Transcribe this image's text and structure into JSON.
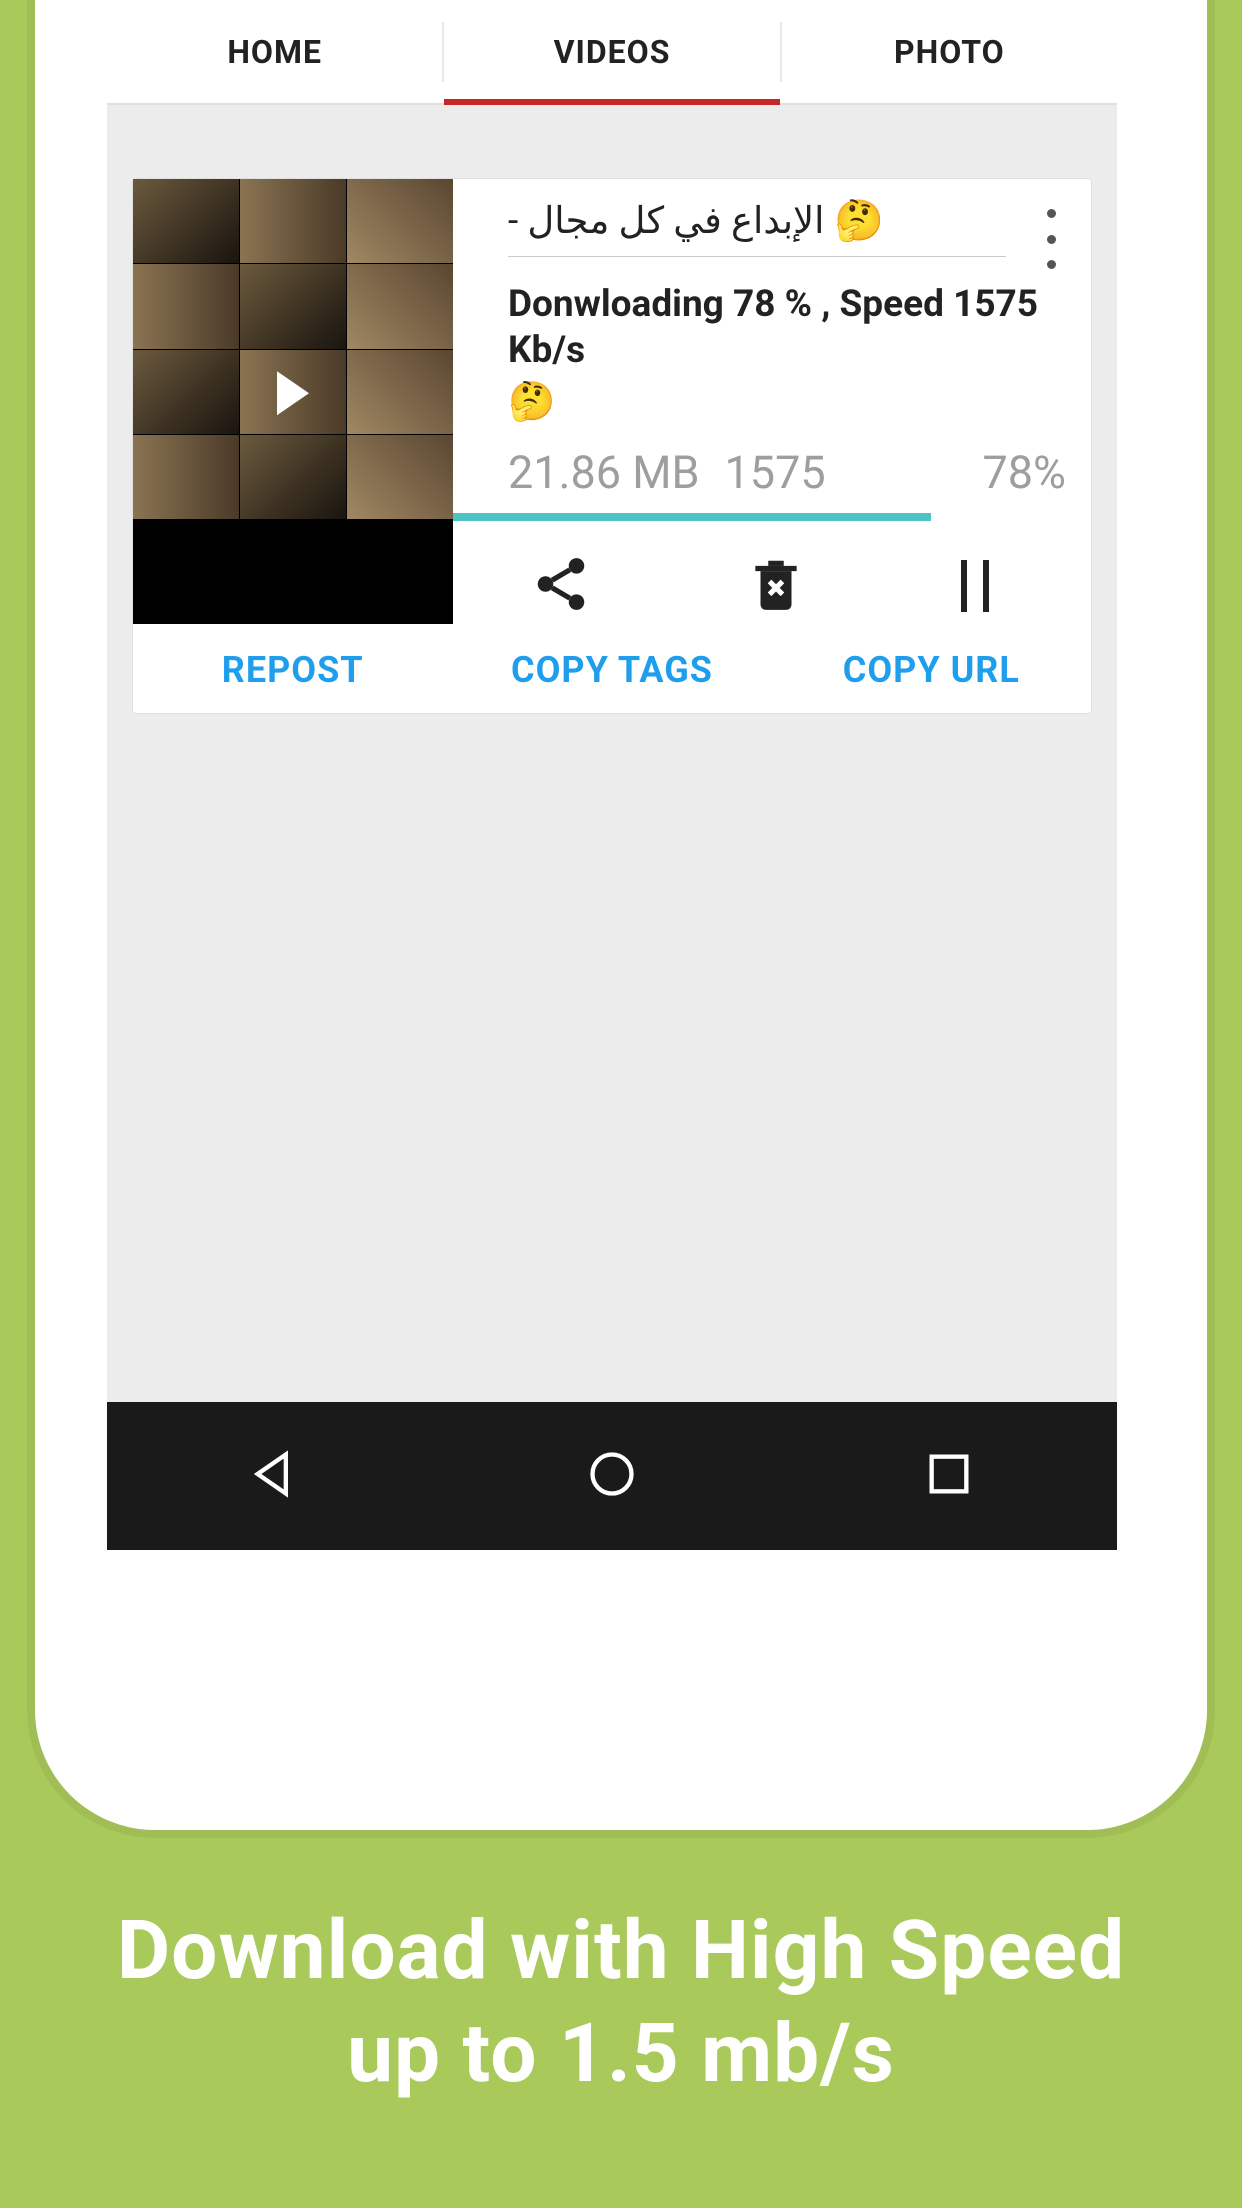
{
  "tabs": {
    "home": "HOME",
    "videos": "VIDEOS",
    "photo": "PHOTO"
  },
  "card": {
    "title": "الإبداع في كل مجال -",
    "title_emoji": "🤔",
    "status": "Donwloading 78 % , Speed 1575 Kb/s",
    "status_emoji": "🤔",
    "size": "21.86 MB",
    "speed": "1575",
    "percent": "78%",
    "progress_pct": 78,
    "actions": {
      "repost": "REPOST",
      "copy_tags": "COPY TAGS",
      "copy_url": "COPY URL"
    }
  },
  "marketing_line1": "Download with High Speed",
  "marketing_line2": "up to 1.5 mb/s",
  "colors": {
    "accent": "#c62828",
    "link": "#1e9eed",
    "progress": "#4ec3c3",
    "bg": "#a9c95a"
  }
}
